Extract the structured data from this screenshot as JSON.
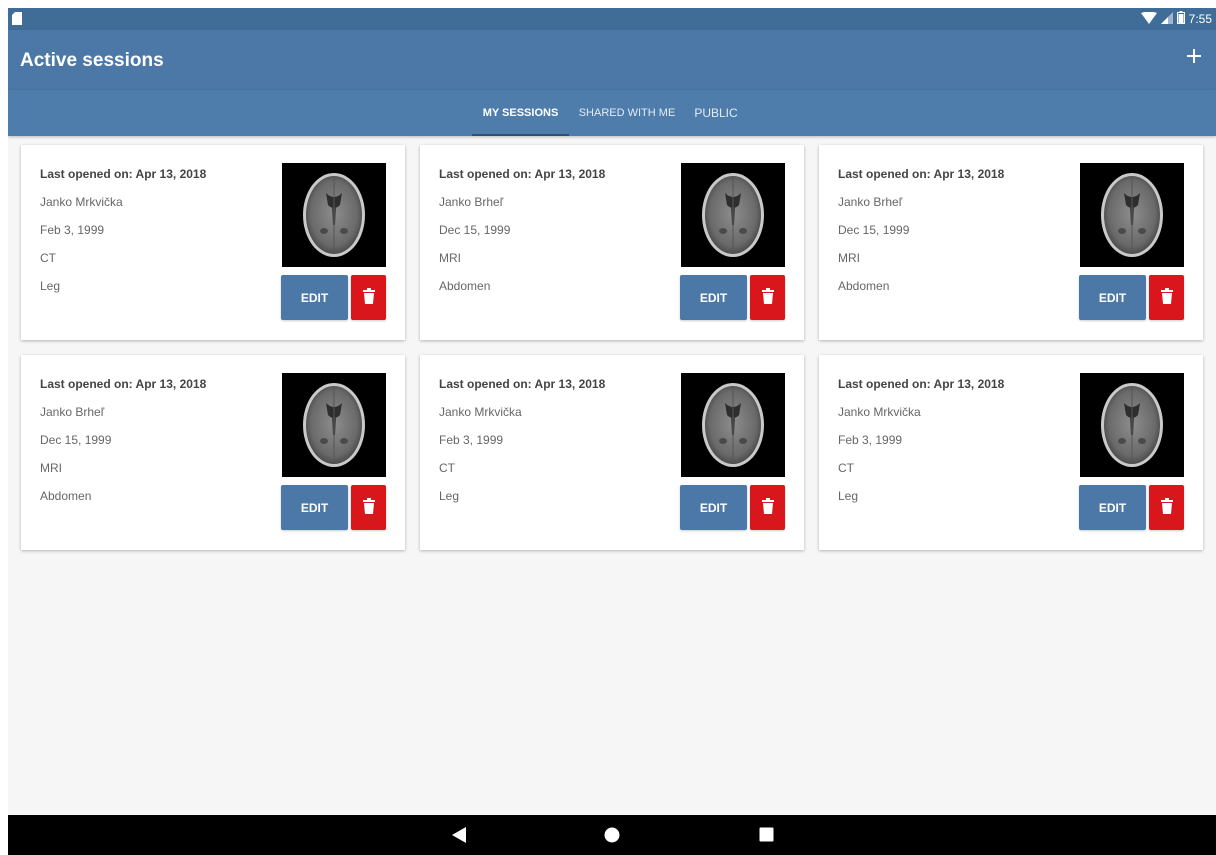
{
  "status_bar": {
    "time": "7:55",
    "icons": [
      "sd-card-icon",
      "wifi-icon",
      "signal-icon",
      "battery-icon"
    ]
  },
  "app_bar": {
    "title": "Active sessions",
    "add_icon": "plus-icon"
  },
  "tabs": [
    {
      "label": "MY SESSIONS",
      "active": true
    },
    {
      "label": "SHARED WITH ME",
      "active": false
    },
    {
      "label": "PUBLIC",
      "active": false
    }
  ],
  "sessions": [
    {
      "last_opened": "Last opened on: Apr 13, 2018",
      "name": "Janko Mrkvička",
      "date": "Feb 3, 1999",
      "modality": "CT",
      "body_part": "Leg",
      "edit_label": "EDIT"
    },
    {
      "last_opened": "Last opened on: Apr 13, 2018",
      "name": "Janko Brheľ",
      "date": "Dec 15, 1999",
      "modality": "MRI",
      "body_part": "Abdomen",
      "edit_label": "EDIT"
    },
    {
      "last_opened": "Last opened on: Apr 13, 2018",
      "name": "Janko Brheľ",
      "date": "Dec 15, 1999",
      "modality": "MRI",
      "body_part": "Abdomen",
      "edit_label": "EDIT"
    },
    {
      "last_opened": "Last opened on: Apr 13, 2018",
      "name": "Janko Brheľ",
      "date": "Dec 15, 1999",
      "modality": "MRI",
      "body_part": "Abdomen",
      "edit_label": "EDIT"
    },
    {
      "last_opened": "Last opened on: Apr 13, 2018",
      "name": "Janko Mrkvička",
      "date": "Feb 3, 1999",
      "modality": "CT",
      "body_part": "Leg",
      "edit_label": "EDIT"
    },
    {
      "last_opened": "Last opened on: Apr 13, 2018",
      "name": "Janko Mrkvička",
      "date": "Feb 3, 1999",
      "modality": "CT",
      "body_part": "Leg",
      "edit_label": "EDIT"
    }
  ],
  "nav_bar": {
    "icons": [
      "back-icon",
      "home-icon",
      "recents-icon"
    ]
  },
  "colors": {
    "primary": "#4b78a6",
    "status_bar": "#3f6d98",
    "delete": "#d8161b",
    "background": "#f6f6f6"
  }
}
